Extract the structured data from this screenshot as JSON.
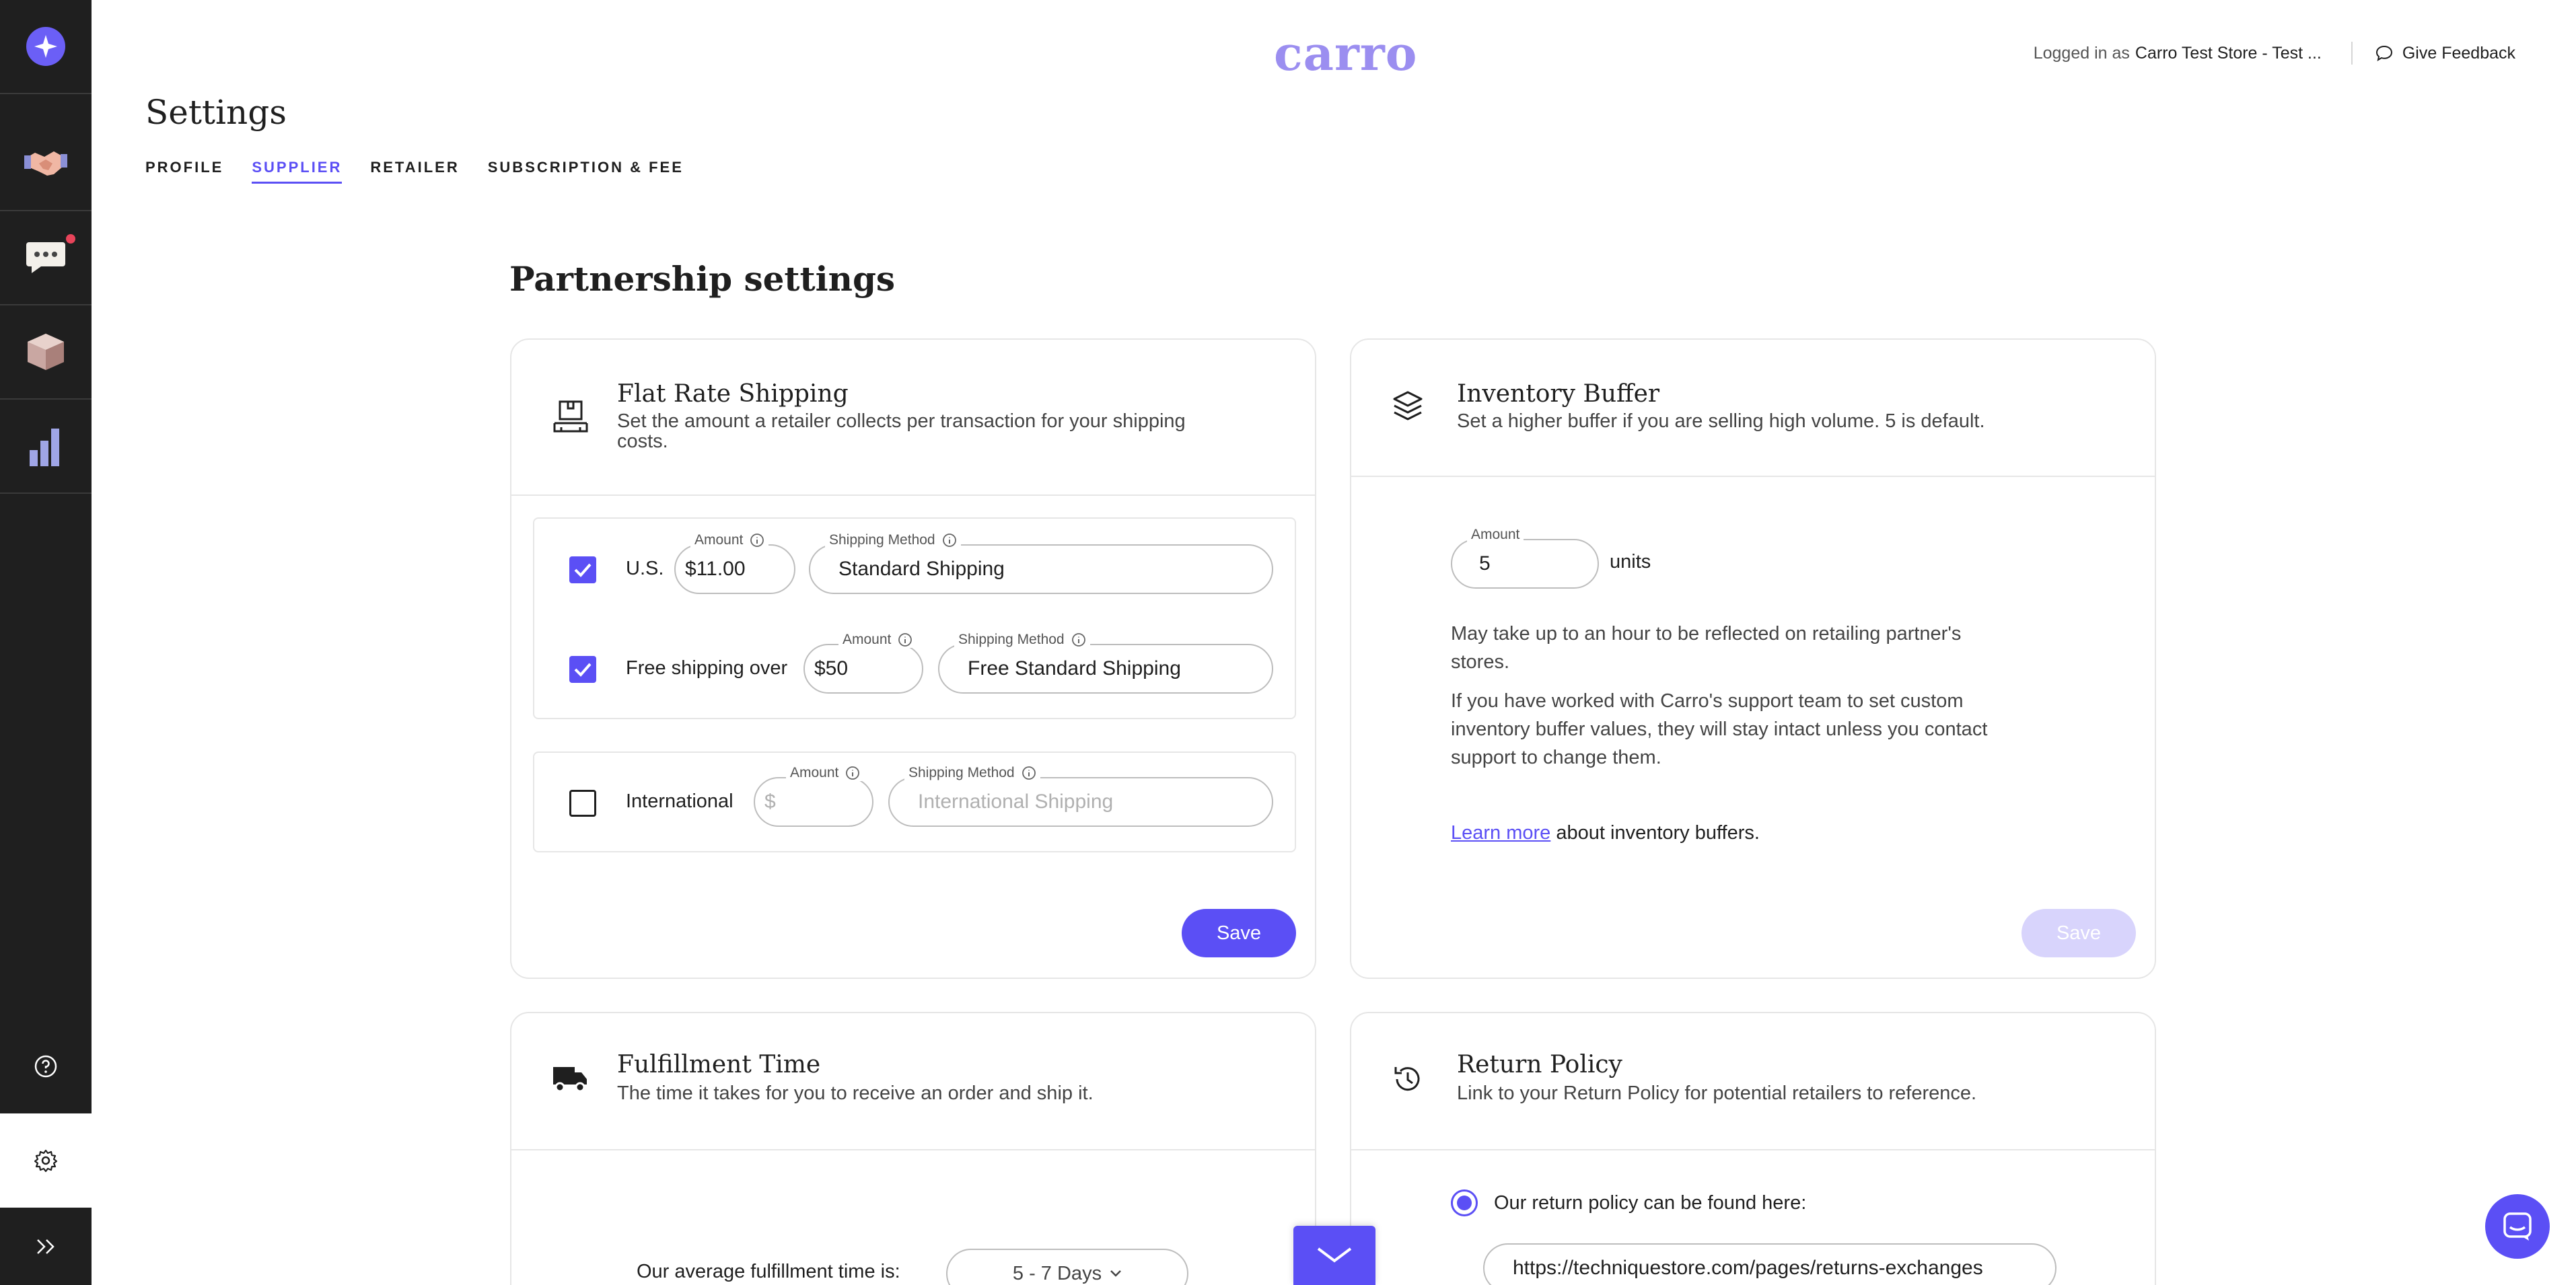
{
  "app": {
    "logo_text": "carro",
    "accent_color": "#5b4ff5"
  },
  "header": {
    "logged_in_prefix": "Logged in as",
    "store_name": "Carro Test Store - Test ...",
    "feedback_label": "Give Feedback"
  },
  "sidebar": {
    "items": [
      {
        "icon": "sparkle-icon"
      },
      {
        "icon": "handshake-icon"
      },
      {
        "icon": "chat-bubble-icon",
        "has_notification": true
      },
      {
        "icon": "box-icon"
      },
      {
        "icon": "bar-chart-icon"
      },
      {
        "icon": "help-circle-icon"
      },
      {
        "icon": "gear-icon",
        "active": true
      },
      {
        "icon": "double-chevron-right-icon"
      }
    ]
  },
  "page": {
    "title": "Settings",
    "tabs": [
      {
        "label": "PROFILE",
        "active": false
      },
      {
        "label": "SUPPLIER",
        "active": true
      },
      {
        "label": "RETAILER",
        "active": false
      },
      {
        "label": "SUBSCRIPTION & FEE",
        "active": false
      }
    ],
    "section_title": "Partnership settings"
  },
  "flat_rate": {
    "title": "Flat Rate Shipping",
    "desc_line1": "Set the amount a retailer collects per transaction for your shipping",
    "desc_line2": "costs.",
    "us": {
      "checked": true,
      "label": "U.S.",
      "amount_label": "Amount",
      "amount_value": "$11.00",
      "method_label": "Shipping Method",
      "method_value": "Standard Shipping"
    },
    "free": {
      "checked": true,
      "label": "Free shipping over",
      "amount_label": "Amount",
      "amount_value": "$50",
      "method_label": "Shipping Method",
      "method_value": "Free Standard Shipping"
    },
    "intl": {
      "checked": false,
      "label": "International",
      "amount_label": "Amount",
      "amount_placeholder": "$",
      "method_label": "Shipping Method",
      "method_placeholder": "International Shipping"
    },
    "save_label": "Save"
  },
  "inventory": {
    "title": "Inventory Buffer",
    "desc": "Set a higher buffer if you are selling high volume. 5 is default.",
    "amount_label": "Amount",
    "amount_value": "5",
    "units": "units",
    "note1_line1": "May take up to an hour to be reflected on retailing partner's",
    "note1_line2": "stores.",
    "note2_line1": "If you have worked with Carro's support team to set custom",
    "note2_line2": "inventory buffer values, they will stay intact unless you contact",
    "note2_line3": "support to change them.",
    "learn_link": "Learn more",
    "learn_rest": "about inventory buffers.",
    "save_label": "Save"
  },
  "fulfillment": {
    "title": "Fulfillment Time",
    "desc": "The time it takes for you to receive an order and ship it.",
    "avg_label": "Our average fulfillment time is:",
    "avg_value": "5 - 7 Days"
  },
  "return_policy": {
    "title": "Return Policy",
    "desc": "Link to your Return Policy for potential retailers to reference.",
    "option_label": "Our return policy can be found here:",
    "url": "https://techniquestore.com/pages/returns-exchanges"
  }
}
